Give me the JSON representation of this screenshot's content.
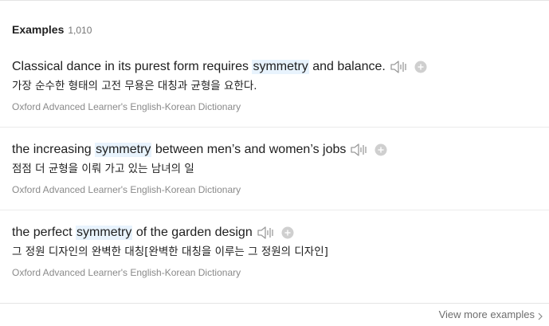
{
  "section": {
    "title": "Examples",
    "count": "1,010"
  },
  "examples": [
    {
      "before": "Classical dance in its purest form requires ",
      "highlight": "symmetry",
      "after": " and balance.",
      "translation": "가장 순수한 형태의 고전 무용은 대칭과 균형을 요한다.",
      "source": "Oxford Advanced Learner's English-Korean Dictionary"
    },
    {
      "before": "the increasing ",
      "highlight": "symmetry",
      "after": " between men’s and women’s jobs",
      "translation": "점점 더 균형을 이뤄 가고 있는 남녀의 일",
      "source": "Oxford Advanced Learner's English-Korean Dictionary"
    },
    {
      "before": "the perfect ",
      "highlight": "symmetry",
      "after": " of the garden design",
      "translation": "그 정원 디자인의 완벽한 대칭[완벽한 대칭을 이루는 그 정원의 디자인]",
      "source": "Oxford Advanced Learner's English-Korean Dictionary"
    }
  ],
  "footer": {
    "view_more": "View more examples"
  },
  "colors": {
    "highlight_bg": "#e8f3fd",
    "icon_gray": "#9a9a9a",
    "plus_gray": "#c8c8c8"
  },
  "icons": {
    "speaker": "speaker-icon",
    "add": "plus-circle-icon",
    "chevron": "chevron-right-icon"
  }
}
